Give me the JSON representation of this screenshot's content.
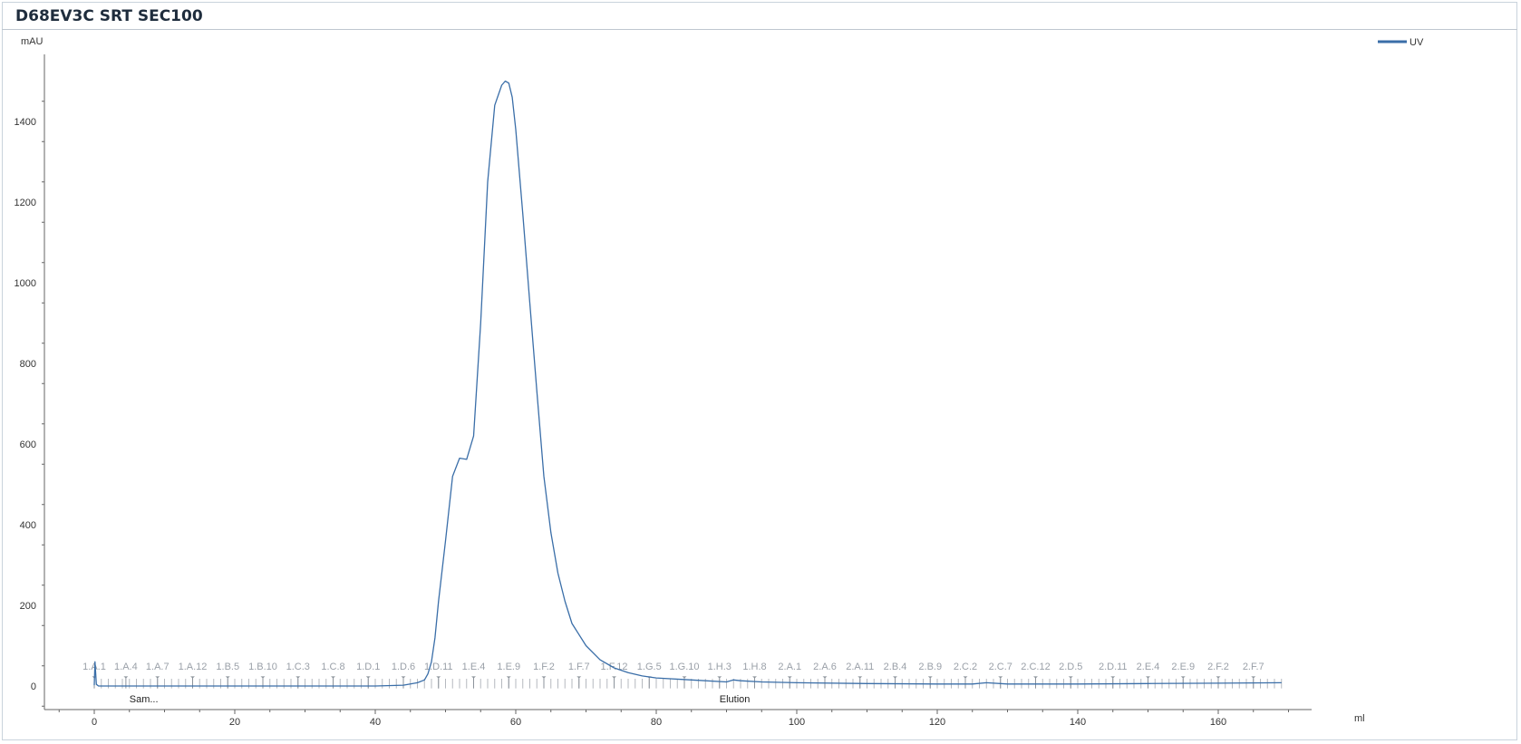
{
  "title": "D68EV3C SRT SEC100",
  "chart_data": {
    "type": "line",
    "title": "D68EV3C SRT SEC100",
    "xlabel": "ml",
    "ylabel": "mAU",
    "xlim": [
      -7,
      172
    ],
    "ylim": [
      -60,
      1560
    ],
    "x_ticks": [
      0,
      20,
      40,
      60,
      80,
      100,
      120,
      140,
      160
    ],
    "y_ticks": [
      0,
      200,
      400,
      600,
      800,
      1000,
      1200,
      1400
    ],
    "grid": false,
    "legend_position": "top-right",
    "series": [
      {
        "name": "UV",
        "color": "#3a6ea8",
        "x": [
          0,
          0.1,
          0.3,
          0.6,
          1.5,
          5,
          10,
          20,
          30,
          40,
          44,
          46,
          47,
          47.5,
          48,
          48.5,
          49,
          50,
          51,
          52,
          53,
          54,
          55,
          56,
          57,
          58,
          58.5,
          59,
          59.5,
          60,
          61,
          62,
          63,
          64,
          65,
          66,
          67,
          68,
          70,
          72,
          74,
          76,
          78,
          80,
          85,
          90,
          91,
          92,
          95,
          100,
          110,
          120,
          125,
          127,
          130,
          140,
          150,
          160,
          169
        ],
        "y": [
          2,
          60,
          4,
          0,
          0,
          0,
          0,
          0,
          0,
          0,
          2,
          8,
          15,
          30,
          60,
          120,
          210,
          360,
          520,
          565,
          562,
          620,
          900,
          1250,
          1440,
          1490,
          1500,
          1495,
          1460,
          1380,
          1170,
          950,
          730,
          520,
          380,
          280,
          210,
          155,
          100,
          65,
          45,
          33,
          25,
          20,
          15,
          10,
          15,
          13,
          10,
          8,
          6,
          5,
          5,
          8,
          5,
          5,
          6,
          7,
          8
        ]
      }
    ],
    "fraction_labels": [
      {
        "label": "1.A.1",
        "x": 0
      },
      {
        "label": "1.A.4",
        "x": 4.5
      },
      {
        "label": "1.A.7",
        "x": 9
      },
      {
        "label": "1.A.12",
        "x": 14
      },
      {
        "label": "1.B.5",
        "x": 19
      },
      {
        "label": "1.B.10",
        "x": 24
      },
      {
        "label": "1.C.3",
        "x": 29
      },
      {
        "label": "1.C.8",
        "x": 34
      },
      {
        "label": "1.D.1",
        "x": 39
      },
      {
        "label": "1.D.6",
        "x": 44
      },
      {
        "label": "1.D.11",
        "x": 49
      },
      {
        "label": "1.E.4",
        "x": 54
      },
      {
        "label": "1.E.9",
        "x": 59
      },
      {
        "label": "1.F.2",
        "x": 64
      },
      {
        "label": "1.F.7",
        "x": 69
      },
      {
        "label": "1.F.12",
        "x": 74
      },
      {
        "label": "1.G.5",
        "x": 79
      },
      {
        "label": "1.G.10",
        "x": 84
      },
      {
        "label": "1.H.3",
        "x": 89
      },
      {
        "label": "1.H.8",
        "x": 94
      },
      {
        "label": "2.A.1",
        "x": 99
      },
      {
        "label": "2.A.6",
        "x": 104
      },
      {
        "label": "2.A.11",
        "x": 109
      },
      {
        "label": "2.B.4",
        "x": 114
      },
      {
        "label": "2.B.9",
        "x": 119
      },
      {
        "label": "2.C.2",
        "x": 124
      },
      {
        "label": "2.C.7",
        "x": 129
      },
      {
        "label": "2.C.12",
        "x": 134
      },
      {
        "label": "2.D.5",
        "x": 139
      },
      {
        "label": "2.D.11",
        "x": 145
      },
      {
        "label": "2.E.4",
        "x": 150
      },
      {
        "label": "2.E.9",
        "x": 155
      },
      {
        "label": "2.F.2",
        "x": 160
      },
      {
        "label": "2.F.7",
        "x": 165
      }
    ],
    "fraction_range": [
      0,
      169
    ],
    "fraction_step": 1,
    "event_markers": [
      {
        "label": "Sam...",
        "x": 5
      },
      {
        "label": "Elution",
        "x": 89
      }
    ]
  }
}
